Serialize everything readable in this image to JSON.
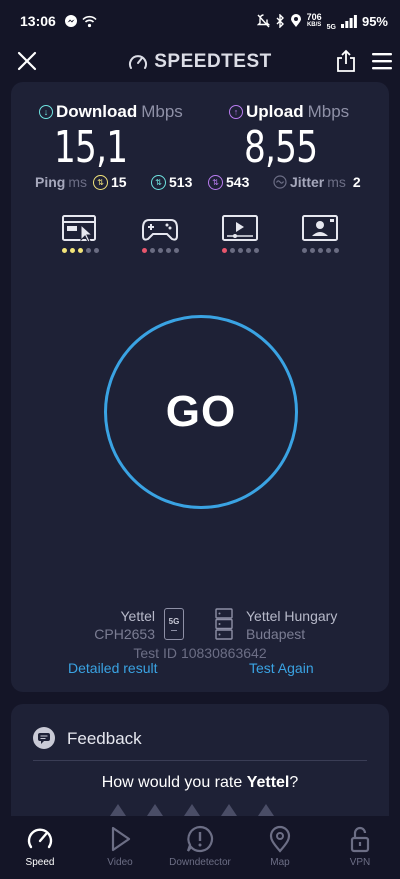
{
  "status": {
    "time": "13:06",
    "net_speed": "706",
    "net_speed_unit": "KB/S",
    "network": "5G",
    "battery": "95%"
  },
  "header": {
    "brand": "SPEEDTEST"
  },
  "result": {
    "download": {
      "label": "Download",
      "unit": "Mbps",
      "value": "15,1"
    },
    "upload": {
      "label": "Upload",
      "unit": "Mbps",
      "value": "8,55"
    },
    "ping": {
      "label": "Ping",
      "unit": "ms",
      "idle": "15",
      "download": "513",
      "upload": "543"
    },
    "jitter": {
      "label": "Jitter",
      "unit": "ms",
      "value": "2"
    }
  },
  "activities": [
    {
      "name": "browsing",
      "rating": 3
    },
    {
      "name": "gaming",
      "rating": 1
    },
    {
      "name": "video",
      "rating": 1
    },
    {
      "name": "video-call",
      "rating": 0
    }
  ],
  "colors": {
    "accent": "#3aa3e3",
    "download": "#6fe3e0",
    "upload": "#b97cf0",
    "ping_idle": "#f2e47a",
    "rating_good": "#f2e47a",
    "rating_bad": "#e8566c"
  },
  "go_label": "GO",
  "connection": {
    "isp": "Yettel",
    "device": "CPH2653",
    "network_badge": "5G",
    "server_name": "Yettel Hungary",
    "server_city": "Budapest",
    "test_id_label": "Test ID",
    "test_id": "10830863642"
  },
  "links": {
    "detailed": "Detailed result",
    "again": "Test Again"
  },
  "feedback": {
    "title": "Feedback",
    "question_prefix": "How would you rate ",
    "question_brand": "Yettel",
    "question_suffix": "?"
  },
  "nav": [
    {
      "label": "Speed",
      "icon": "speedometer-icon",
      "active": true
    },
    {
      "label": "Video",
      "icon": "play-icon",
      "active": false
    },
    {
      "label": "Downdetector",
      "icon": "alert-icon",
      "active": false
    },
    {
      "label": "Map",
      "icon": "map-pin-icon",
      "active": false
    },
    {
      "label": "VPN",
      "icon": "lock-icon",
      "active": false
    }
  ]
}
